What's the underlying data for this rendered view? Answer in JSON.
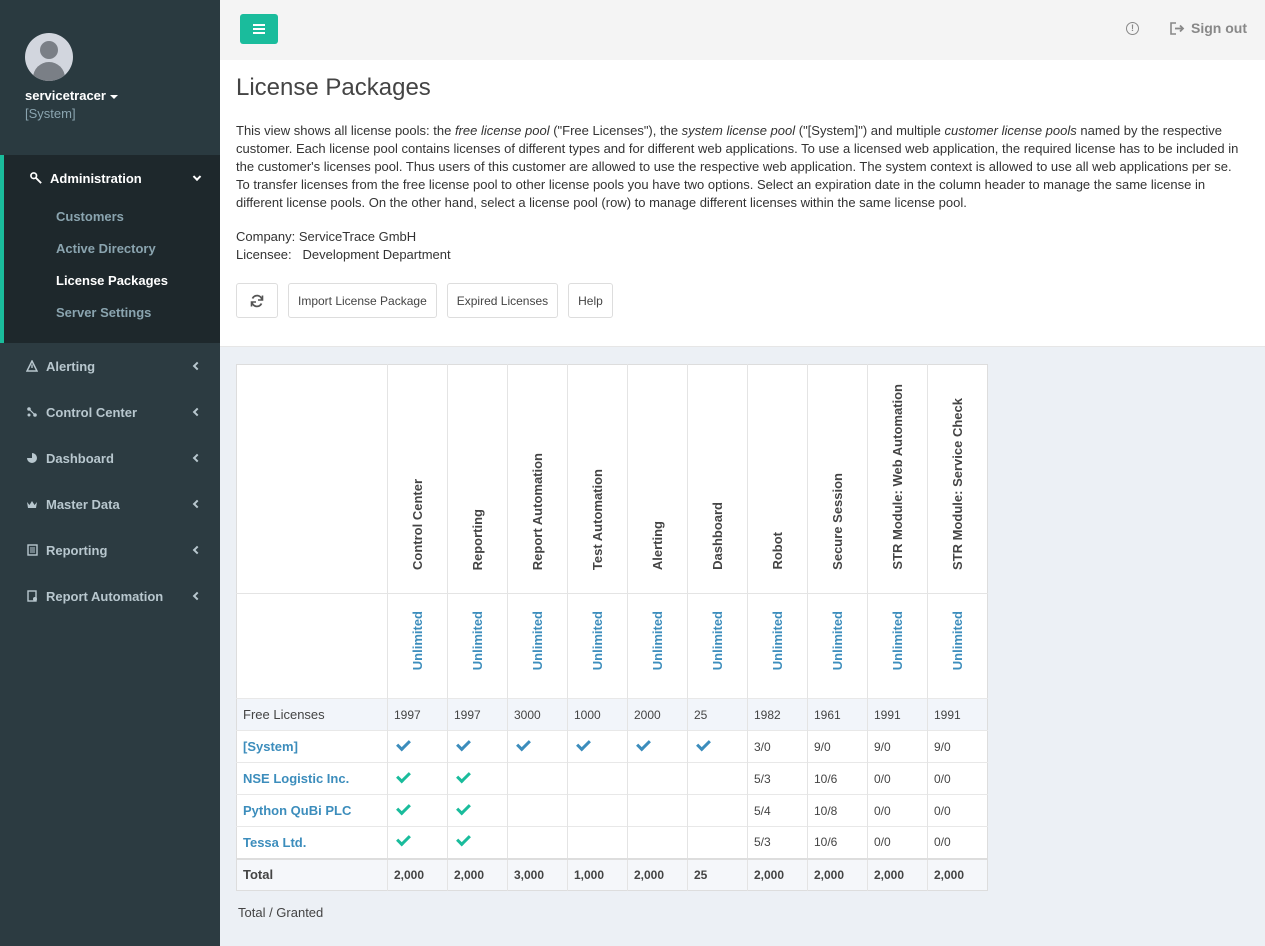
{
  "sidebar": {
    "user_name": "servicetracer",
    "user_context": "[System]",
    "admin_label": "Administration",
    "admin_subitems": [
      "Customers",
      "Active Directory",
      "License Packages",
      "Server Settings"
    ],
    "items": [
      {
        "label": "Alerting",
        "icon": "warning-icon"
      },
      {
        "label": "Control Center",
        "icon": "sitemap-icon"
      },
      {
        "label": "Dashboard",
        "icon": "pie-chart-icon"
      },
      {
        "label": "Master Data",
        "icon": "crown-icon"
      },
      {
        "label": "Reporting",
        "icon": "list-icon"
      },
      {
        "label": "Report Automation",
        "icon": "document-gear-icon"
      }
    ]
  },
  "header": {
    "signout_label": "Sign out"
  },
  "page": {
    "title": "License Packages",
    "desc_1": "This view shows all license pools: the ",
    "desc_em1": "free license pool",
    "desc_2": " (\"Free Licenses\"), the ",
    "desc_em2": "system license pool",
    "desc_3": " (\"[System]\") and multiple ",
    "desc_em3": "customer license pools",
    "desc_4": " named by the respective customer. Each license pool contains licenses of different types and for different web applications. To use a licensed web application, the required license has to be included in the customer's licenses pool. Thus users of this customer are allowed to use the respective web application. The system context is allowed to use all web applications per se. To transfer licenses from the free license pool to other license pools you have two options. Select an expiration date in the column header to manage the same license in different license pools. On the other hand, select a license pool (row) to manage different licenses within the same license pool.",
    "company_label": "Company:",
    "company_value": "ServiceTrace GmbH",
    "licensee_label": "Licensee:",
    "licensee_value": "Development Department",
    "buttons": {
      "import": "Import License Package",
      "expired": "Expired Licenses",
      "help": "Help"
    },
    "footnote": "Total / Granted"
  },
  "table": {
    "columns": [
      "Control Center",
      "Reporting",
      "Report Automation",
      "Test Automation",
      "Alerting",
      "Dashboard",
      "Robot",
      "Secure Session",
      "STR Module: Web Automation",
      "STR Module: Service Check"
    ],
    "expiry": [
      "Unlimited",
      "Unlimited",
      "Unlimited",
      "Unlimited",
      "Unlimited",
      "Unlimited",
      "Unlimited",
      "Unlimited",
      "Unlimited",
      "Unlimited"
    ],
    "free_row": {
      "name": "Free Licenses",
      "values": [
        "1997",
        "1997",
        "3000",
        "1000",
        "2000",
        "25",
        "1982",
        "1961",
        "1991",
        "1991"
      ]
    },
    "rows": [
      {
        "name": "[System]",
        "cells": [
          "check-blue",
          "check-blue",
          "check-blue",
          "check-blue",
          "check-blue",
          "check-blue",
          "3/0",
          "9/0",
          "9/0",
          "9/0"
        ]
      },
      {
        "name": "NSE Logistic Inc.",
        "cells": [
          "check-green",
          "check-green",
          "",
          "",
          "",
          "",
          "5/3",
          "10/6",
          "0/0",
          "0/0"
        ]
      },
      {
        "name": "Python QuBi PLC",
        "cells": [
          "check-green",
          "check-green",
          "",
          "",
          "",
          "",
          "5/4",
          "10/8",
          "0/0",
          "0/0"
        ]
      },
      {
        "name": "Tessa Ltd.",
        "cells": [
          "check-green",
          "check-green",
          "",
          "",
          "",
          "",
          "5/3",
          "10/6",
          "0/0",
          "0/0"
        ]
      }
    ],
    "total_row": {
      "name": "Total",
      "values": [
        "2,000",
        "2,000",
        "3,000",
        "1,000",
        "2,000",
        "25",
        "2,000",
        "2,000",
        "2,000",
        "2,000"
      ]
    }
  },
  "colors": {
    "accent": "#1abc9c",
    "link": "#3c8dbc",
    "sidebar": "#2c3b41"
  }
}
